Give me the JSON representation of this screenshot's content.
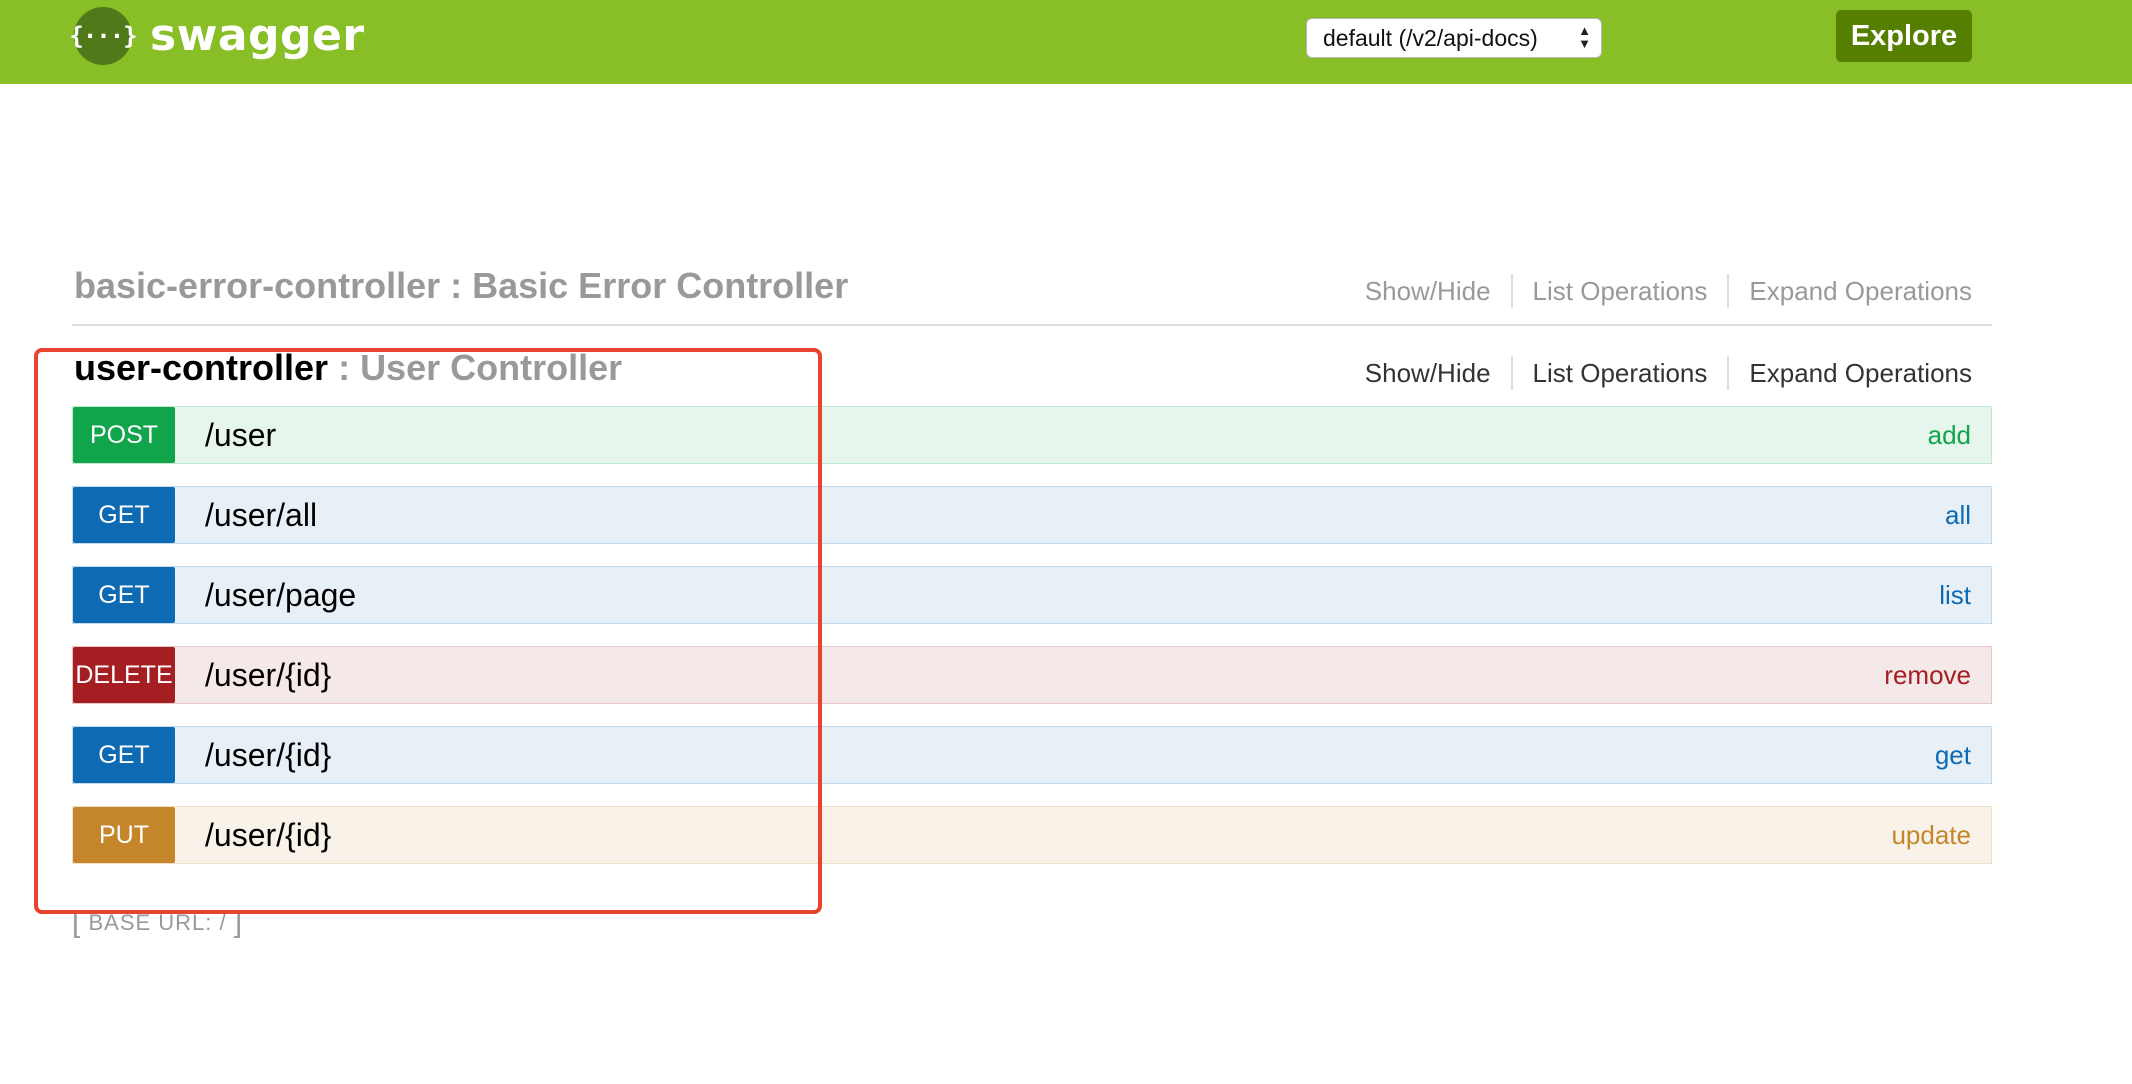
{
  "header": {
    "logo_glyph": "{···}",
    "logo_text": "swagger",
    "spec_select": {
      "selected": "default (/v2/api-docs)"
    },
    "explore_label": "Explore",
    "colors": {
      "bar": "#89bf26",
      "explore": "#547f00"
    }
  },
  "resources": [
    {
      "name": "basic-error-controller",
      "description": "Basic Error Controller",
      "links": {
        "show_hide": "Show/Hide",
        "list_ops": "List Operations",
        "expand_ops": "Expand Operations"
      }
    },
    {
      "name": "user-controller",
      "description": "User Controller",
      "links": {
        "show_hide": "Show/Hide",
        "list_ops": "List Operations",
        "expand_ops": "Expand Operations"
      },
      "operations": [
        {
          "method": "POST",
          "path": "/user",
          "name": "add"
        },
        {
          "method": "GET",
          "path": "/user/all",
          "name": "all"
        },
        {
          "method": "GET",
          "path": "/user/page",
          "name": "list"
        },
        {
          "method": "DELETE",
          "path": "/user/{id}",
          "name": "remove"
        },
        {
          "method": "GET",
          "path": "/user/{id}",
          "name": "get"
        },
        {
          "method": "PUT",
          "path": "/user/{id}",
          "name": "update"
        }
      ]
    }
  ],
  "footer": {
    "base_url_label": "BASE URL",
    "base_url_value": "/"
  },
  "method_colors": {
    "POST": "#10a54a",
    "GET": "#0f6ab4",
    "DELETE": "#a41e22",
    "PUT": "#c5862b"
  },
  "annotation_color": "#e8432e"
}
